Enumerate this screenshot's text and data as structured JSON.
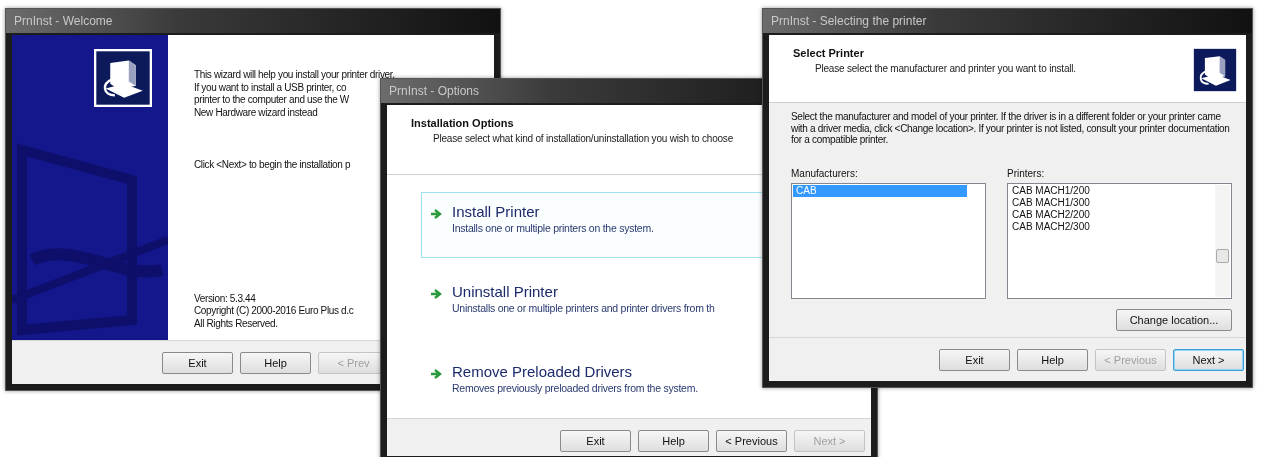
{
  "windows": [
    {
      "kind": "welcome",
      "title": "PrnInst - Welcome",
      "lines": [
        "This wizard will help you install your printer driver.",
        "If you want to install a USB printer, co",
        "printer to the computer and use the W",
        "New Hardware wizard instead"
      ],
      "click_text": "Click <Next> to begin the installation p",
      "version": "Version: 5.3.44",
      "copyright": "Copyright (C) 2000-2016 Euro Plus d.c",
      "rights": "All Rights Reserved.",
      "buttons": [
        {
          "label": "Exit",
          "disabled": false,
          "default": false
        },
        {
          "label": "Help",
          "disabled": false,
          "default": false
        },
        {
          "label": "< Prev",
          "disabled": true,
          "default": false
        }
      ]
    },
    {
      "kind": "options",
      "title": "PrnInst - Options",
      "heading": "Installation Options",
      "subheading": "Please select what kind of installation/uninstallation you wish to choose",
      "options": [
        {
          "title": "Install Printer",
          "description": "Installs one or multiple printers on the system.",
          "selected": true
        },
        {
          "title": "Uninstall Printer",
          "description": "Uninstalls one or multiple printers and printer drivers from th",
          "selected": false
        },
        {
          "title": "Remove Preloaded Drivers",
          "description": "Removes previously preloaded drivers from the system.",
          "selected": false
        }
      ],
      "buttons": [
        {
          "label": "Exit",
          "disabled": false,
          "default": false
        },
        {
          "label": "Help",
          "disabled": false,
          "default": false
        },
        {
          "label": "< Previous",
          "disabled": false,
          "default": false
        },
        {
          "label": "Next >",
          "disabled": true,
          "default": false
        }
      ]
    },
    {
      "kind": "select",
      "title": "PrnInst - Selecting the printer",
      "heading": "Select Printer",
      "subheading": "Please select the manufacturer and printer you want to install.",
      "description": "Select the manufacturer and model of your printer. If the driver is in a different folder or your printer came with a driver media, click <Change location>. If your printer is not listed, consult your printer documentation for a compatible printer.",
      "manufacturers_label": "Manufacturers:",
      "manufacturers": [
        {
          "label": "CAB",
          "selected": true
        }
      ],
      "printers_label": "Printers:",
      "printers": [
        {
          "label": "CAB MACH1/200",
          "selected": false
        },
        {
          "label": "CAB MACH1/300",
          "selected": false
        },
        {
          "label": "CAB MACH2/200",
          "selected": false
        },
        {
          "label": "CAB MACH2/300",
          "selected": false
        }
      ],
      "change_location": "Change location...",
      "buttons": [
        {
          "label": "Exit",
          "disabled": false,
          "default": false
        },
        {
          "label": "Help",
          "disabled": false,
          "default": false
        },
        {
          "label": "< Previous",
          "disabled": true,
          "default": false
        },
        {
          "label": "Next >",
          "disabled": false,
          "default": true
        }
      ]
    }
  ]
}
